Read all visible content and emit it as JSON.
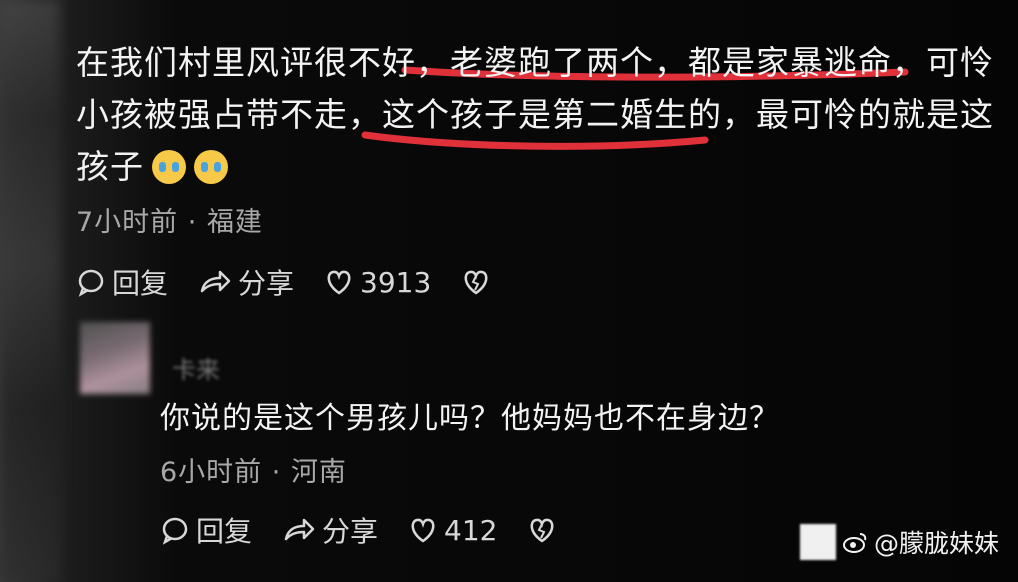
{
  "comments": [
    {
      "text": "在我们村里风评很不好，老婆跑了两个，都是家暴逃命，可怜小孩被强占带不走，这个孩子是第二婚生的，最可怜的就是这孩子",
      "time": "7小时前",
      "location": "福建",
      "reply_label": "回复",
      "share_label": "分享",
      "likes": "3913"
    },
    {
      "username": "卡来",
      "text": "你说的是这个男孩儿吗？他妈妈也不在身边？",
      "time": "6小时前",
      "location": "河南",
      "reply_label": "回复",
      "share_label": "分享",
      "likes": "412"
    }
  ],
  "watermark": {
    "text": "@朦胧妹妹"
  },
  "colors": {
    "underline": "#e0303a",
    "meta": "#a8a8a8",
    "background": "#050505"
  },
  "icons": [
    "crying-emoji-icon",
    "reply-icon",
    "share-icon",
    "heart-icon",
    "broken-heart-icon",
    "weibo-icon"
  ]
}
